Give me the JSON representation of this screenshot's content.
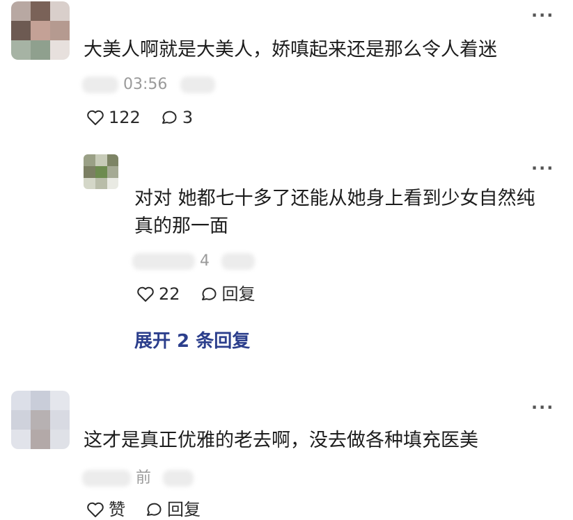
{
  "comments": [
    {
      "text": "大美人啊就是大美人，娇嗔起来还是那么令人着迷",
      "time": "03:56",
      "likes": "122",
      "replies": "3",
      "more": "···"
    },
    {
      "text_line1": "对对 她都七十多了还能从她身上看到少女自然纯",
      "text_line2": "真的那一面",
      "time": "4",
      "likes": "22",
      "reply_label": "回复",
      "more": "···"
    },
    {
      "text": "这才是真正优雅的老去啊，没去做各种填充医美",
      "time": "前",
      "like_label": "赞",
      "reply_label": "回复",
      "more": "···"
    }
  ],
  "expand_replies": "展开 2 条回复",
  "colors": {
    "link": "#2b3e8c",
    "meta": "#9a9a9a",
    "text": "#1c1c1c"
  }
}
